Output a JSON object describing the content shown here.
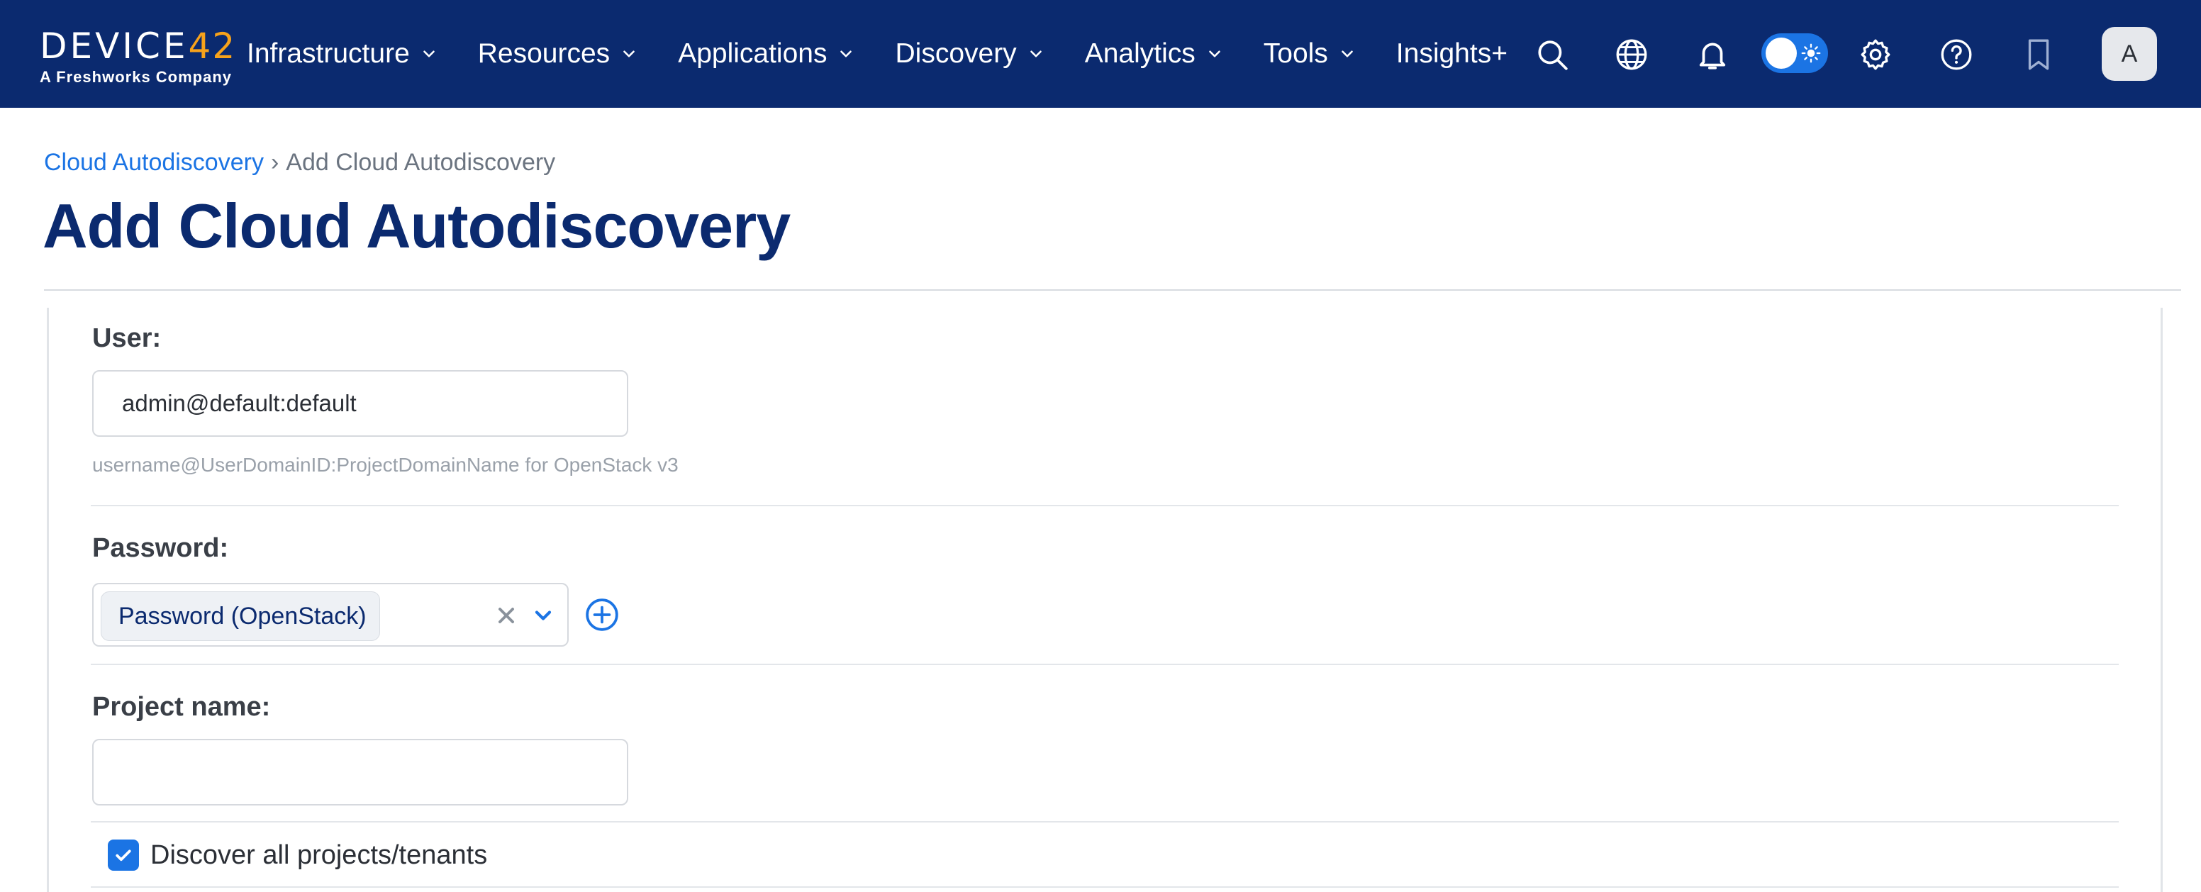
{
  "logo": {
    "main": "DEVICE",
    "number": "42",
    "sub": "A Freshworks Company"
  },
  "nav": {
    "items": [
      {
        "label": "Infrastructure"
      },
      {
        "label": "Resources"
      },
      {
        "label": "Applications"
      },
      {
        "label": "Discovery"
      },
      {
        "label": "Analytics"
      },
      {
        "label": "Tools"
      },
      {
        "label": "Insights+"
      }
    ],
    "icons": [
      "search-icon",
      "globe-icon",
      "bell-icon",
      "theme-toggle",
      "gear-icon",
      "help-icon",
      "bookmark-icon"
    ],
    "avatar": "A"
  },
  "breadcrumb": {
    "parent": "Cloud Autodiscovery",
    "separator": "›",
    "current": "Add Cloud Autodiscovery"
  },
  "page_title": "Add Cloud Autodiscovery",
  "form": {
    "user": {
      "label": "User:",
      "value": "admin@default:default",
      "hint": "username@UserDomainID:ProjectDomainName for OpenStack v3"
    },
    "password": {
      "label": "Password:",
      "selected": "Password (OpenStack)"
    },
    "project_name": {
      "label": "Project name:",
      "value": ""
    },
    "discover_all": {
      "label": "Discover all projects/tenants",
      "checked": true
    }
  },
  "colors": {
    "nav_bg": "#0b2a6f",
    "accent": "#1b74e4",
    "logo_accent": "#f7a21b"
  }
}
